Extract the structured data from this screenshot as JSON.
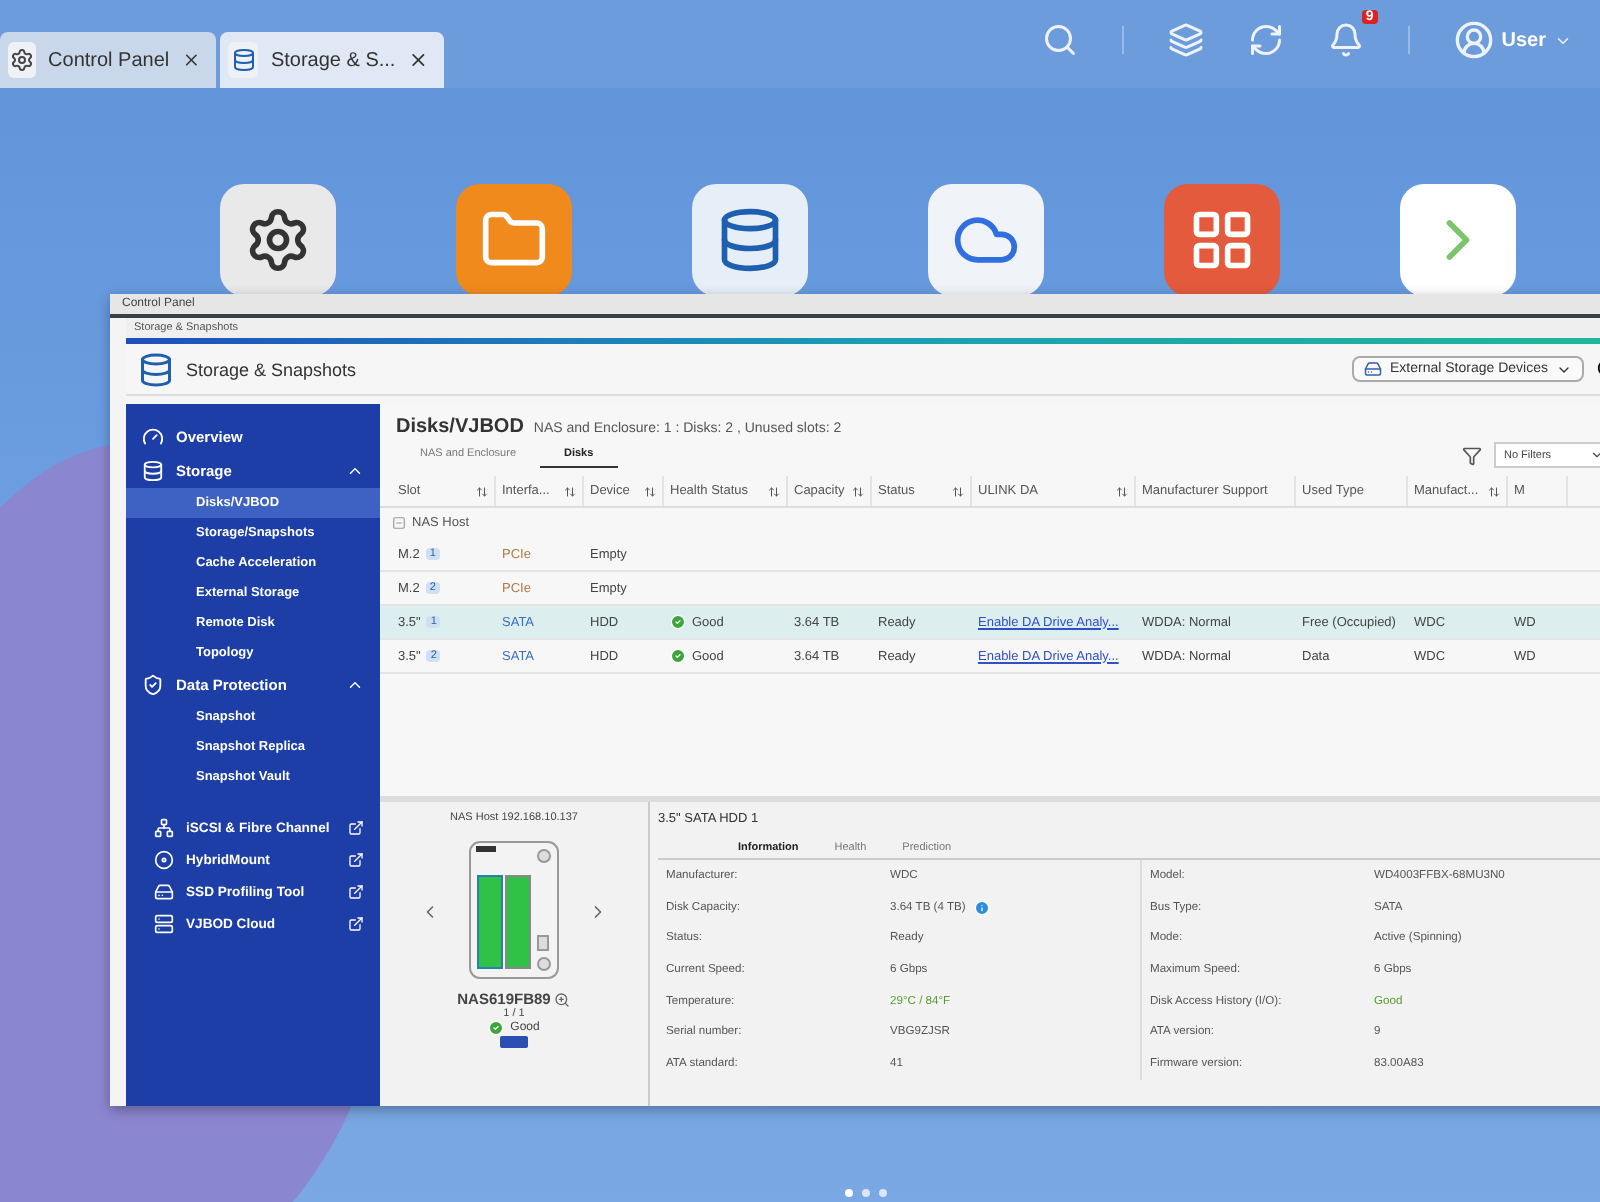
{
  "top_bar": {
    "tabs": [
      {
        "label": "Control Panel",
        "selected": false
      },
      {
        "label": "Storage & S...",
        "selected": true
      }
    ],
    "notification_count": "9",
    "user": "User"
  },
  "window": {
    "title": "Control Panel",
    "app_title": "Storage & Snapshots",
    "header_title": "Storage & Snapshots",
    "device_select": "External Storage Devices"
  },
  "sidebar": {
    "overview": "Overview",
    "groups": [
      {
        "label": "Storage",
        "expanded": true,
        "items": [
          {
            "label": "Disks/VJBOD",
            "selected": true
          },
          {
            "label": "Storage/Snapshots",
            "selected": false
          },
          {
            "label": "Cache Acceleration",
            "selected": false
          },
          {
            "label": "External Storage",
            "selected": false
          },
          {
            "label": "Remote Disk",
            "selected": false
          },
          {
            "label": "Topology",
            "selected": false
          }
        ]
      },
      {
        "label": "Data Protection",
        "expanded": true,
        "items": [
          {
            "label": "Snapshot",
            "selected": false
          },
          {
            "label": "Snapshot Replica",
            "selected": false
          },
          {
            "label": "Snapshot Vault",
            "selected": false
          }
        ]
      }
    ],
    "external_tools": [
      "iSCSI & Fibre Channel",
      "HybridMount",
      "SSD Profiling Tool",
      "VJBOD Cloud"
    ]
  },
  "content": {
    "title": "Disks/VJBOD",
    "summary": "NAS and Enclosure: 1 : Disks: 2 , Unused slots: 2",
    "tabs": [
      {
        "label": "NAS and Enclosure",
        "selected": false
      },
      {
        "label": "Disks",
        "selected": true
      }
    ],
    "filter": "No Filters",
    "table": {
      "columns": [
        {
          "label": "Slot",
          "sortable": true
        },
        {
          "label": "Interfa...",
          "sortable": true
        },
        {
          "label": "Device",
          "sortable": true
        },
        {
          "label": "Health Status",
          "sortable": true
        },
        {
          "label": "Capacity",
          "sortable": true
        },
        {
          "label": "Status",
          "sortable": true
        },
        {
          "label": "ULINK DA",
          "sortable": true
        },
        {
          "label": "Manufacturer Support",
          "sortable": false
        },
        {
          "label": "Used Type",
          "sortable": false
        },
        {
          "label": "Manufact...",
          "sortable": true
        },
        {
          "label": "M",
          "sortable": false
        }
      ],
      "group": "NAS Host",
      "rows": [
        {
          "slot": "M.2",
          "slot_number": "1",
          "interface": "PCIe",
          "kind": "empty",
          "device": "Empty",
          "health": "",
          "capacity": "",
          "status": "",
          "ulink_da": "",
          "manufacturer_support": "",
          "used_type": "",
          "manufacturer": "",
          "column_11": "",
          "selected": false
        },
        {
          "slot": "M.2",
          "slot_number": "2",
          "interface": "PCIe",
          "kind": "empty",
          "device": "Empty",
          "health": "",
          "capacity": "",
          "status": "",
          "ulink_da": "",
          "manufacturer_support": "",
          "used_type": "",
          "manufacturer": "",
          "column_11": "",
          "selected": false
        },
        {
          "slot": "3.5\"",
          "slot_number": "1",
          "interface": "SATA",
          "kind": "disk",
          "device": "HDD",
          "health": "Good",
          "capacity": "3.64 TB",
          "status": "Ready",
          "ulink_da": "Enable DA Drive Analy...",
          "manufacturer_support": "WDDA: Normal",
          "used_type": "Free (Occupied)",
          "manufacturer": "WDC",
          "column_11": "WD",
          "selected": true
        },
        {
          "slot": "3.5\"",
          "slot_number": "2",
          "interface": "SATA",
          "kind": "disk",
          "device": "HDD",
          "health": "Good",
          "capacity": "3.64 TB",
          "status": "Ready",
          "ulink_da": "Enable DA Drive Analy...",
          "manufacturer_support": "WDDA: Normal",
          "used_type": "Data",
          "manufacturer": "WDC",
          "column_11": "WD",
          "selected": false
        }
      ]
    }
  },
  "detail": {
    "nas": {
      "host": "NAS Host 192.168.10.137",
      "name": "NAS619FB89",
      "page": "1 / 1",
      "health": "Good"
    },
    "disk": {
      "title": "3.5\" SATA HDD 1",
      "tabs": [
        {
          "label": "Information",
          "selected": true
        },
        {
          "label": "Health",
          "selected": false
        },
        {
          "label": "Prediction",
          "selected": false
        }
      ],
      "left_fields": [
        {
          "label": "Manufacturer:",
          "value": "WDC",
          "good": false,
          "info": false
        },
        {
          "label": "Disk Capacity:",
          "value": "3.64 TB (4 TB)",
          "good": false,
          "info": true
        },
        {
          "label": "Status:",
          "value": "Ready",
          "good": false,
          "info": false
        },
        {
          "label": "Current Speed:",
          "value": "6 Gbps",
          "good": false,
          "info": false
        },
        {
          "label": "Temperature:",
          "value": "29°C / 84°F",
          "good": true,
          "info": false
        },
        {
          "label": "Serial number:",
          "value": "VBG9ZJSR",
          "good": false,
          "info": false
        },
        {
          "label": "ATA standard:",
          "value": "41",
          "good": false,
          "info": false
        }
      ],
      "right_fields": [
        {
          "label": "Model:",
          "value": "WD4003FFBX-68MU3N0",
          "good": false,
          "info": false
        },
        {
          "label": "Bus Type:",
          "value": "SATA",
          "good": false,
          "info": false
        },
        {
          "label": "Mode:",
          "value": "Active (Spinning)",
          "good": false,
          "info": false
        },
        {
          "label": "Maximum Speed:",
          "value": "6 Gbps",
          "good": false,
          "info": false
        },
        {
          "label": "Disk Access History (I/O):",
          "value": "Good",
          "good": true,
          "info": false
        },
        {
          "label": "ATA version:",
          "value": "9",
          "good": false,
          "info": false
        },
        {
          "label": "Firmware version:",
          "value": "83.00A83",
          "good": false,
          "info": false
        }
      ]
    }
  }
}
